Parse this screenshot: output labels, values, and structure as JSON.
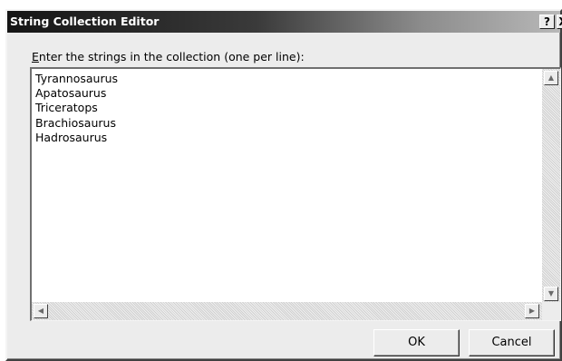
{
  "window": {
    "title": "String Collection Editor",
    "help_label": "?",
    "close_label": "X"
  },
  "prompt": {
    "accel": "E",
    "rest": "nter the strings in the collection (one per line):"
  },
  "editor": {
    "lines": [
      "Tyrannosaurus",
      "Apatosaurus",
      "Triceratops",
      "Brachiosaurus",
      "Hadrosaurus"
    ]
  },
  "scroll_icons": {
    "up": "▲",
    "down": "▼",
    "left": "◀",
    "right": "▶"
  },
  "buttons": {
    "ok_label": "OK",
    "cancel_label": "Cancel"
  }
}
